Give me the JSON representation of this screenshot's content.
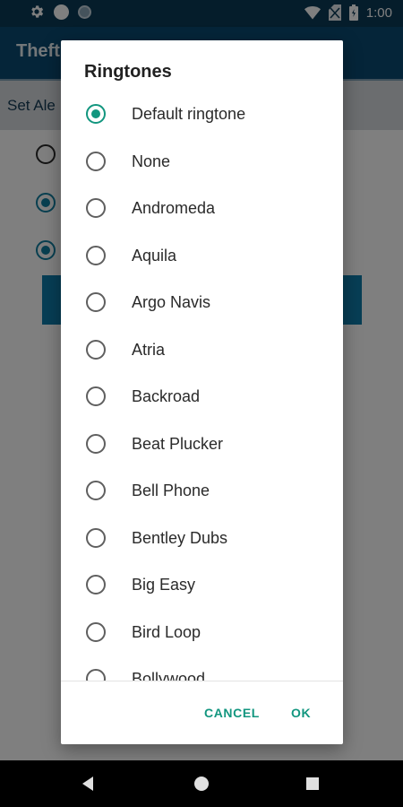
{
  "status_bar": {
    "time": "1:00",
    "icons": [
      "settings-gear-icon",
      "circle-icon",
      "circle-outline-icon",
      "wifi-icon",
      "no-sim-icon",
      "battery-icon"
    ]
  },
  "app": {
    "title": "Theft",
    "subtitle": "Set Ale"
  },
  "dialog": {
    "title": "Ringtones",
    "selected": "Default ringtone",
    "items": [
      "Default ringtone",
      "None",
      "Andromeda",
      "Aquila",
      "Argo Navis",
      "Atria",
      "Backroad",
      "Beat Plucker",
      "Bell Phone",
      "Bentley Dubs",
      "Big Easy",
      "Bird Loop",
      "Bollywood"
    ],
    "cancel_label": "CANCEL",
    "ok_label": "OK"
  },
  "colors": {
    "accent": "#12967f",
    "app_bar": "#0a4a72",
    "status_bar": "#0a3a57"
  }
}
